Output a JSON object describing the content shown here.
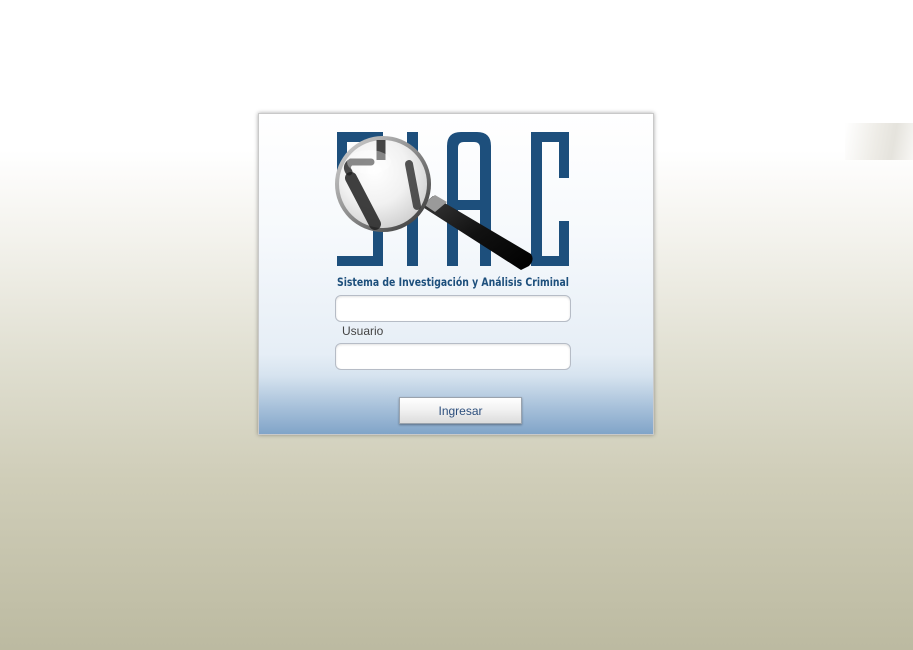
{
  "brand": {
    "logo_text": "SIAC",
    "subtitle": "Sistema de Investigación y Análisis Criminal",
    "color": "#1d4f7c"
  },
  "login_form": {
    "username_label": "Usuario",
    "username_value": "",
    "password_value": "",
    "submit_label": "Ingresar"
  }
}
